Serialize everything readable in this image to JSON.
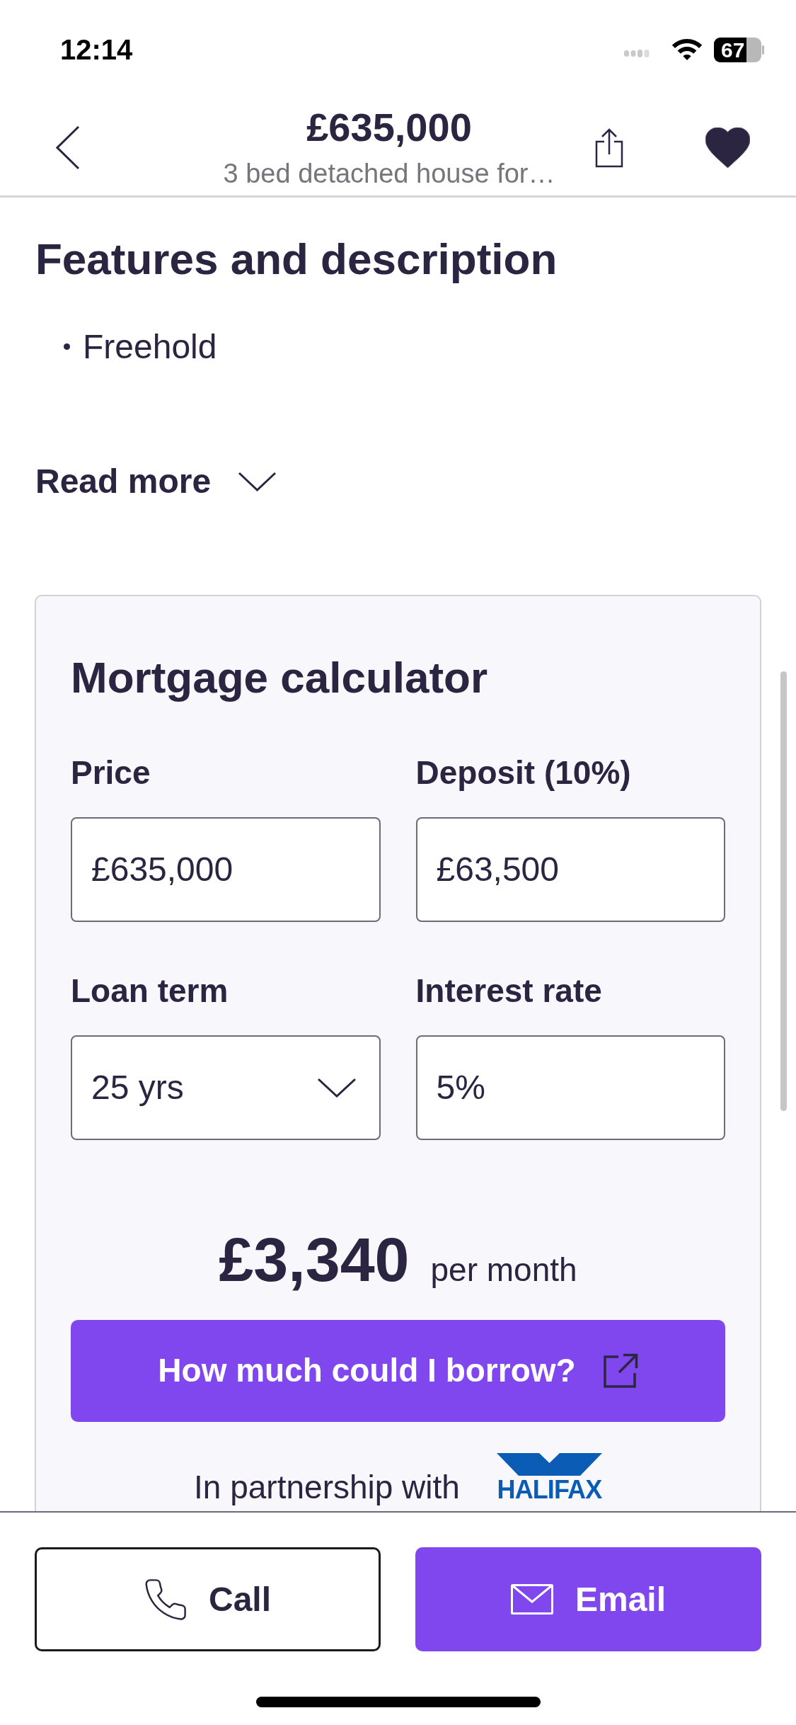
{
  "status_bar": {
    "time": "12:14",
    "battery": "67"
  },
  "header": {
    "title": "£635,000",
    "subtitle": "3 bed detached house for…",
    "favourite": true
  },
  "features": {
    "heading": "Features and description",
    "items": [
      "Freehold"
    ],
    "read_more": "Read more"
  },
  "mortgage_calculator": {
    "title": "Mortgage calculator",
    "fields": [
      {
        "label": "Price",
        "value": "£635,000",
        "kind": "input"
      },
      {
        "label": "Deposit (10%)",
        "value": "£63,500",
        "kind": "input"
      },
      {
        "label": "Loan term",
        "value": "25 yrs",
        "kind": "select"
      },
      {
        "label": "Interest rate",
        "value": "5%",
        "kind": "input"
      }
    ],
    "result": {
      "amount": "£3,340",
      "period": "per month"
    },
    "borrow_button": "How much could I borrow?",
    "partnership": {
      "text": "In partnership with",
      "logo": "HALIFAX"
    }
  },
  "actions": [
    {
      "kind": "call",
      "label": "Call"
    },
    {
      "kind": "email",
      "label": "Email"
    }
  ]
}
